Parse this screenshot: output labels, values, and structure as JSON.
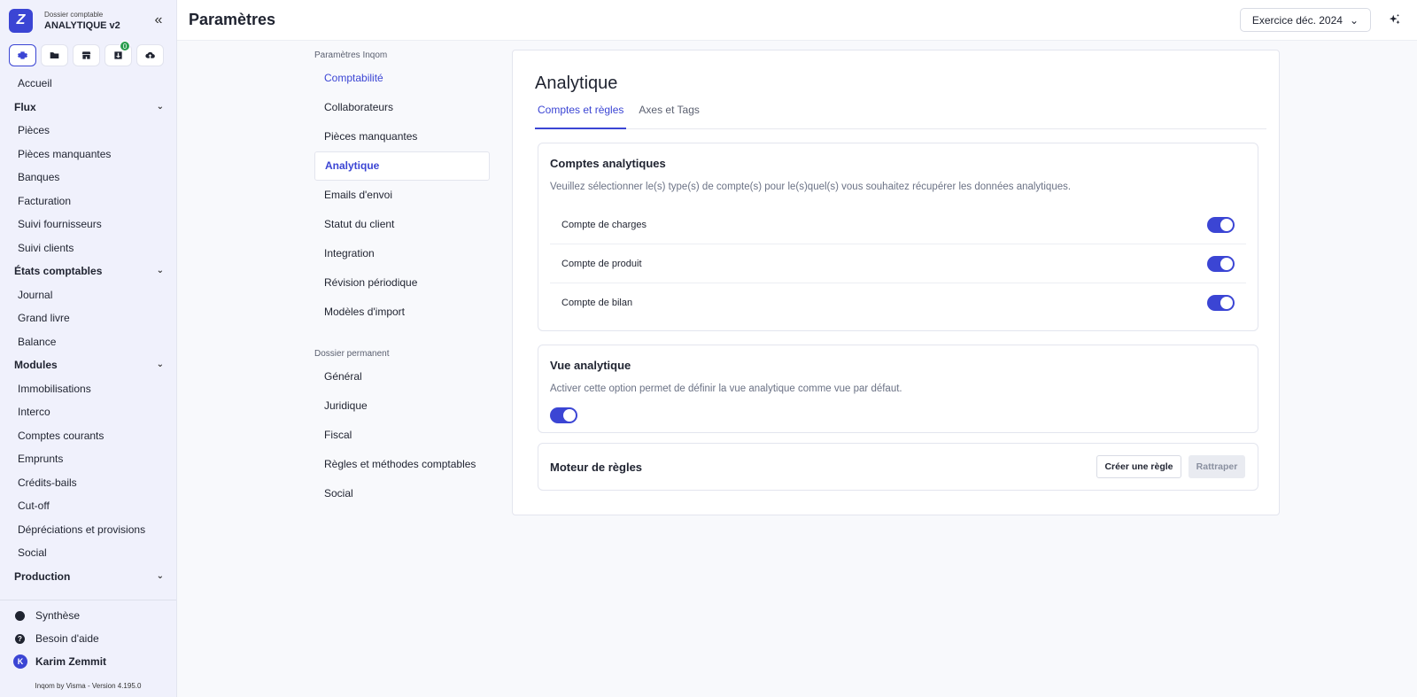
{
  "sidebar": {
    "brand_sub": "Dossier comptable",
    "brand_name": "ANALYTIQUE v2",
    "brand_logo": "Z",
    "icons": [
      "gear-icon",
      "folder-icon",
      "store-icon",
      "inbox-icon",
      "cloud-upload-icon"
    ],
    "inbox_badge": "0",
    "accueil": "Accueil",
    "flux": {
      "label": "Flux",
      "items": [
        "Pièces",
        "Pièces manquantes",
        "Banques",
        "Facturation",
        "Suivi fournisseurs",
        "Suivi clients"
      ]
    },
    "etats": {
      "label": "États comptables",
      "items": [
        "Journal",
        "Grand livre",
        "Balance"
      ]
    },
    "modules": {
      "label": "Modules",
      "items": [
        "Immobilisations",
        "Interco",
        "Comptes courants",
        "Emprunts",
        "Crédits-bails",
        "Cut-off",
        "Dépréciations et provisions",
        "Social"
      ]
    },
    "production": {
      "label": "Production"
    },
    "bottom": {
      "synthese": "Synthèse",
      "aide": "Besoin d'aide",
      "user_initial": "K",
      "user": "Karim Zemmit"
    },
    "version": "Inqom by Visma - Version 4.195.0"
  },
  "topbar": {
    "title": "Paramètres",
    "exercice": "Exercice déc. 2024"
  },
  "settings_nav": {
    "section1_label": "Paramètres Inqom",
    "section1": [
      "Comptabilité",
      "Collaborateurs",
      "Pièces manquantes",
      "Analytique",
      "Emails d'envoi",
      "Statut du client",
      "Integration",
      "Révision périodique",
      "Modèles d'import"
    ],
    "section2_label": "Dossier permanent",
    "section2": [
      "Général",
      "Juridique",
      "Fiscal",
      "Règles et méthodes comptables",
      "Social"
    ]
  },
  "main": {
    "title": "Analytique",
    "tabs": [
      "Comptes et règles",
      "Axes et Tags"
    ],
    "comptes": {
      "title": "Comptes analytiques",
      "desc": "Veuillez sélectionner le(s) type(s) de compte(s) pour le(s)quel(s) vous souhaitez récupérer les données analytiques.",
      "rows": [
        "Compte de charges",
        "Compte de produit",
        "Compte de bilan"
      ]
    },
    "vue": {
      "title": "Vue analytique",
      "desc": "Activer cette option permet de définir la vue analytique comme vue par défaut."
    },
    "moteur": {
      "title": "Moteur de règles",
      "create": "Créer une règle",
      "rattraper": "Rattraper"
    }
  }
}
